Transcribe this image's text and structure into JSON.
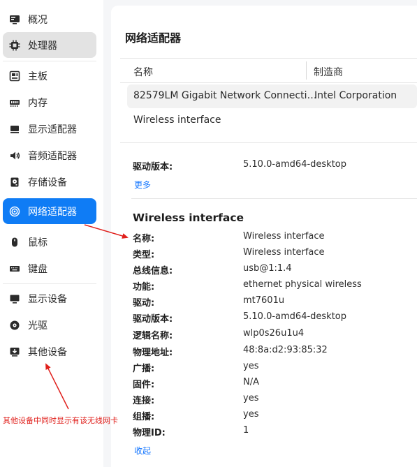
{
  "sidebar": {
    "items": [
      {
        "label": "概况",
        "icon": "overview-icon"
      },
      {
        "label": "处理器",
        "icon": "cpu-icon"
      },
      {
        "label": "主板",
        "icon": "motherboard-icon"
      },
      {
        "label": "内存",
        "icon": "memory-icon"
      },
      {
        "label": "显示适配器",
        "icon": "display-adapter-icon"
      },
      {
        "label": "音频适配器",
        "icon": "audio-icon"
      },
      {
        "label": "存储设备",
        "icon": "storage-icon"
      },
      {
        "label": "网络适配器",
        "icon": "network-icon"
      },
      {
        "label": "鼠标",
        "icon": "mouse-icon"
      },
      {
        "label": "键盘",
        "icon": "keyboard-icon"
      },
      {
        "label": "显示设备",
        "icon": "monitor-icon"
      },
      {
        "label": "光驱",
        "icon": "optical-drive-icon"
      },
      {
        "label": "其他设备",
        "icon": "other-devices-icon"
      }
    ],
    "active_item": "网络适配器",
    "selected_item": "处理器"
  },
  "main": {
    "title": "网络适配器",
    "table": {
      "columns": [
        "名称",
        "制造商"
      ],
      "rows": [
        {
          "name": "82579LM Gigabit Network Connecti…",
          "vendor": "Intel Corporation"
        },
        {
          "name": "Wireless interface",
          "vendor": ""
        }
      ]
    },
    "first_device": {
      "driver_version_label": "驱动版本:",
      "driver_version": "5.10.0-amd64-desktop",
      "more_link": "更多"
    },
    "detail": {
      "title": "Wireless interface",
      "fields": [
        {
          "label": "名称:",
          "value": "Wireless interface"
        },
        {
          "label": "类型:",
          "value": "Wireless interface"
        },
        {
          "label": "总线信息:",
          "value": "usb@1:1.4"
        },
        {
          "label": "功能:",
          "value": "ethernet physical wireless"
        },
        {
          "label": "驱动:",
          "value": "mt7601u"
        },
        {
          "label": "驱动版本:",
          "value": "5.10.0-amd64-desktop"
        },
        {
          "label": "逻辑名称:",
          "value": "wlp0s26u1u4"
        },
        {
          "label": "物理地址:",
          "value": "48:8a:d2:93:85:32"
        },
        {
          "label": "广播:",
          "value": "yes"
        },
        {
          "label": "固件:",
          "value": "N/A"
        },
        {
          "label": "连接:",
          "value": "yes"
        },
        {
          "label": "组播:",
          "value": "yes"
        },
        {
          "label": "物理ID:",
          "value": "1"
        }
      ],
      "collapse_link": "收起"
    }
  },
  "annotation": {
    "text": "其他设备中同时显示有该无线网卡",
    "color": "#e0201c"
  },
  "colors": {
    "accent": "#0f7cf5",
    "link": "#1677ff",
    "selected_bg": "#e3e3e3"
  }
}
